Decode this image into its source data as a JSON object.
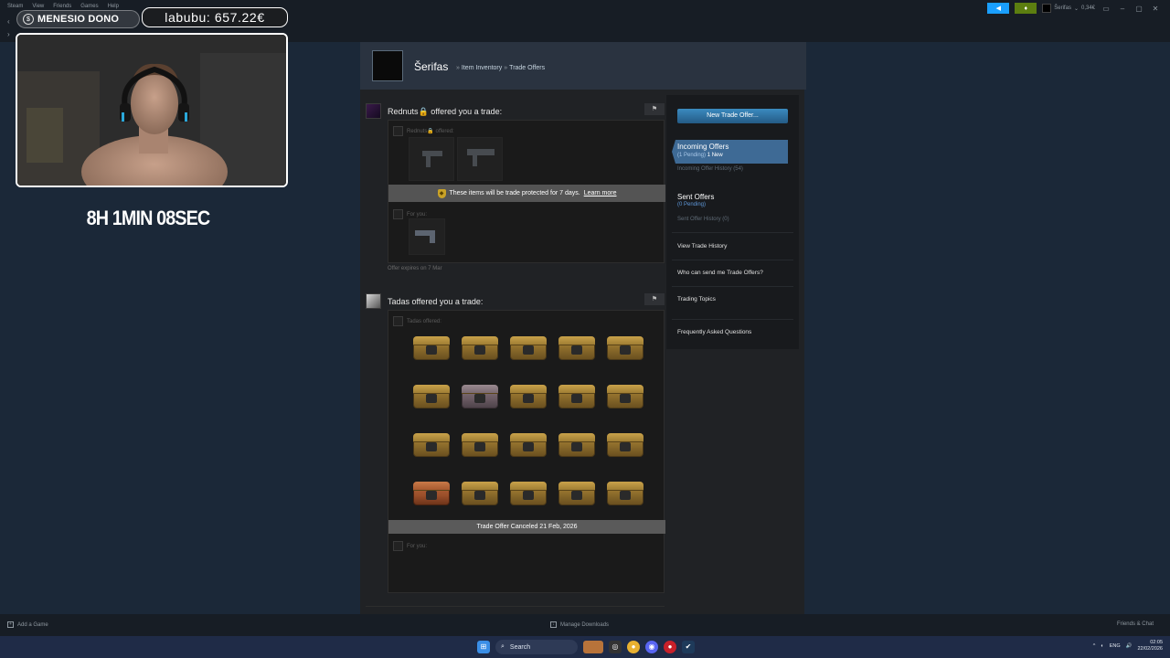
{
  "app": {
    "menu": [
      "Steam",
      "View",
      "Friends",
      "Games",
      "Help"
    ],
    "account_name": "Šerifas",
    "account_balance": "0,34€"
  },
  "overlay": {
    "donate_text": "MENESIO DONO",
    "goal_text": "labubu: 657.22€",
    "timer": "8H 1MIN 08SEC"
  },
  "profile": {
    "name": "Šerifas",
    "breadcrumb": [
      "Item Inventory",
      "Trade Offers"
    ],
    "breadcrumb_sep": "»"
  },
  "offers": [
    {
      "title": "Rednuts🔒 offered you a trade:",
      "party_offered": "Rednuts🔒 offered:",
      "notice": "These items will be trade protected for 7 days.",
      "notice_link": "Learn more",
      "for_you": "For you:",
      "expires": "Offer expires on 7 Mar"
    },
    {
      "title": "Tadas offered you a trade:",
      "party_offered": "Tadas offered:",
      "status": "Trade Offer Canceled 21 Feb, 2026",
      "for_you": "For you:"
    }
  ],
  "sidebar": {
    "new_offer": "New Trade Offer...",
    "incoming": "Incoming Offers",
    "incoming_pending": "(1 Pending)",
    "incoming_new": "1 New",
    "incoming_history": "Incoming Offer History (54)",
    "sent": "Sent Offers",
    "sent_pending": "(0 Pending)",
    "sent_history": "Sent Offer History (0)",
    "view_history": "View Trade History",
    "who_can_send": "Who can send me Trade Offers?",
    "topics": "Trading Topics",
    "faq": "Frequently Asked Questions"
  },
  "bottombar": {
    "add_game": "Add a Game",
    "manage_downloads": "Manage Downloads",
    "friends_chat": "Friends & Chat"
  },
  "taskbar": {
    "search": "Search",
    "lang": "ENG",
    "time": "02:05",
    "date": "22/02/2026"
  },
  "colors": {
    "steam_bg": "#1b2838",
    "accent": "#3e6a95",
    "header_bg": "#2a3340"
  }
}
